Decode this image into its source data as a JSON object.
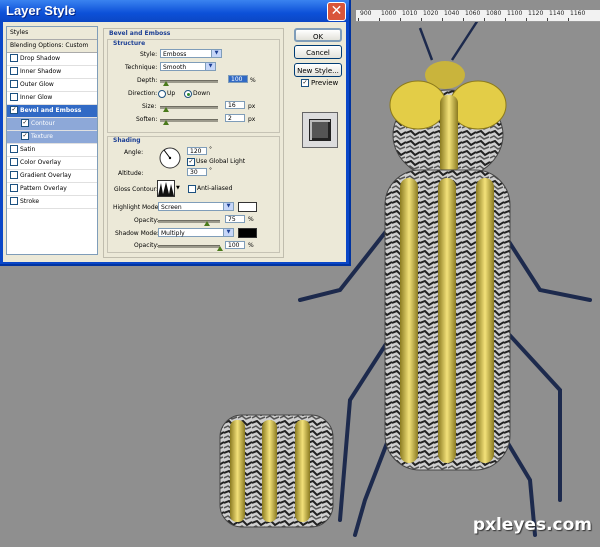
{
  "window": {
    "title": "Layer Style",
    "close_label": "✕"
  },
  "ruler": {
    "ticks": [
      "900",
      "1000",
      "1010",
      "1020",
      "1040",
      "1060",
      "1080",
      "1100",
      "1120",
      "1140",
      "1160"
    ]
  },
  "watermark": "pxleyes.com",
  "styles_list": [
    {
      "label": "Styles",
      "type": "header"
    },
    {
      "label": "Blending Options: Custom",
      "type": "header"
    },
    {
      "label": "Drop Shadow",
      "checked": false
    },
    {
      "label": "Inner Shadow",
      "checked": false
    },
    {
      "label": "Outer Glow",
      "checked": false
    },
    {
      "label": "Inner Glow",
      "checked": false
    },
    {
      "label": "Bevel and Emboss",
      "checked": true,
      "selected": true
    },
    {
      "label": "Contour",
      "checked": true,
      "sub": true
    },
    {
      "label": "Texture",
      "checked": true,
      "sub": true
    },
    {
      "label": "Satin",
      "checked": false
    },
    {
      "label": "Color Overlay",
      "checked": false
    },
    {
      "label": "Gradient Overlay",
      "checked": false
    },
    {
      "label": "Pattern Overlay",
      "checked": false
    },
    {
      "label": "Stroke",
      "checked": false
    }
  ],
  "bevel": {
    "section_title": "Bevel and Emboss",
    "structure_title": "Structure",
    "style_label": "Style:",
    "style_value": "Emboss",
    "technique_label": "Technique:",
    "technique_value": "Smooth",
    "depth_label": "Depth:",
    "depth_value": "100",
    "depth_unit": "%",
    "direction_label": "Direction:",
    "dir_up": "Up",
    "dir_down": "Down",
    "size_label": "Size:",
    "size_value": "16",
    "size_unit": "px",
    "soften_label": "Soften:",
    "soften_value": "2",
    "soften_unit": "px",
    "shading_title": "Shading",
    "angle_label": "Angle:",
    "angle_value": "120",
    "degree": "°",
    "global_light_label": "Use Global Light",
    "altitude_label": "Altitude:",
    "altitude_value": "30",
    "gloss_label": "Gloss Contour:",
    "antialiased_label": "Anti-aliased",
    "highlight_label": "Highlight Mode:",
    "highlight_value": "Screen",
    "h_opacity_label": "Opacity:",
    "h_opacity_value": "75",
    "pct": "%",
    "shadow_label": "Shadow Mode:",
    "shadow_value": "Multiply",
    "s_opacity_label": "Opacity:",
    "s_opacity_value": "100"
  },
  "buttons": {
    "ok": "OK",
    "cancel": "Cancel",
    "new_style": "New Style...",
    "preview": "Preview"
  },
  "colors": {
    "dialog_bg": "#ece9d8",
    "title_blue": "#0c50d8",
    "canvas_gray": "#8f8f8f"
  }
}
